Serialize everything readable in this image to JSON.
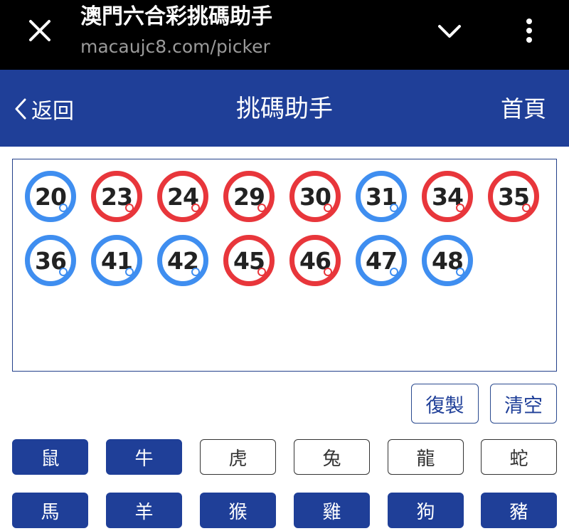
{
  "browser": {
    "title": "澳門六合彩挑碼助手",
    "url": "macaujc8.com/picker"
  },
  "header": {
    "back_label": "返回",
    "title": "挑碼助手",
    "home_label": "首頁"
  },
  "balls": [
    {
      "number": "20",
      "color": "blue"
    },
    {
      "number": "23",
      "color": "red"
    },
    {
      "number": "24",
      "color": "red"
    },
    {
      "number": "29",
      "color": "red"
    },
    {
      "number": "30",
      "color": "red"
    },
    {
      "number": "31",
      "color": "blue"
    },
    {
      "number": "34",
      "color": "red"
    },
    {
      "number": "35",
      "color": "red"
    },
    {
      "number": "36",
      "color": "blue"
    },
    {
      "number": "41",
      "color": "blue"
    },
    {
      "number": "42",
      "color": "blue"
    },
    {
      "number": "45",
      "color": "red"
    },
    {
      "number": "46",
      "color": "red"
    },
    {
      "number": "47",
      "color": "blue"
    },
    {
      "number": "48",
      "color": "blue"
    }
  ],
  "actions": {
    "copy_label": "復製",
    "clear_label": "清空"
  },
  "zodiac": [
    {
      "label": "鼠",
      "selected": true
    },
    {
      "label": "牛",
      "selected": true
    },
    {
      "label": "虎",
      "selected": false
    },
    {
      "label": "兔",
      "selected": false
    },
    {
      "label": "龍",
      "selected": false
    },
    {
      "label": "蛇",
      "selected": false
    },
    {
      "label": "馬",
      "selected": true
    },
    {
      "label": "羊",
      "selected": true
    },
    {
      "label": "猴",
      "selected": true
    },
    {
      "label": "雞",
      "selected": true
    },
    {
      "label": "狗",
      "selected": true
    },
    {
      "label": "豬",
      "selected": true
    }
  ],
  "colors": {
    "brand_blue": "#1f3f98",
    "ball_red": "#e8363b",
    "ball_blue": "#3f8ef0"
  }
}
